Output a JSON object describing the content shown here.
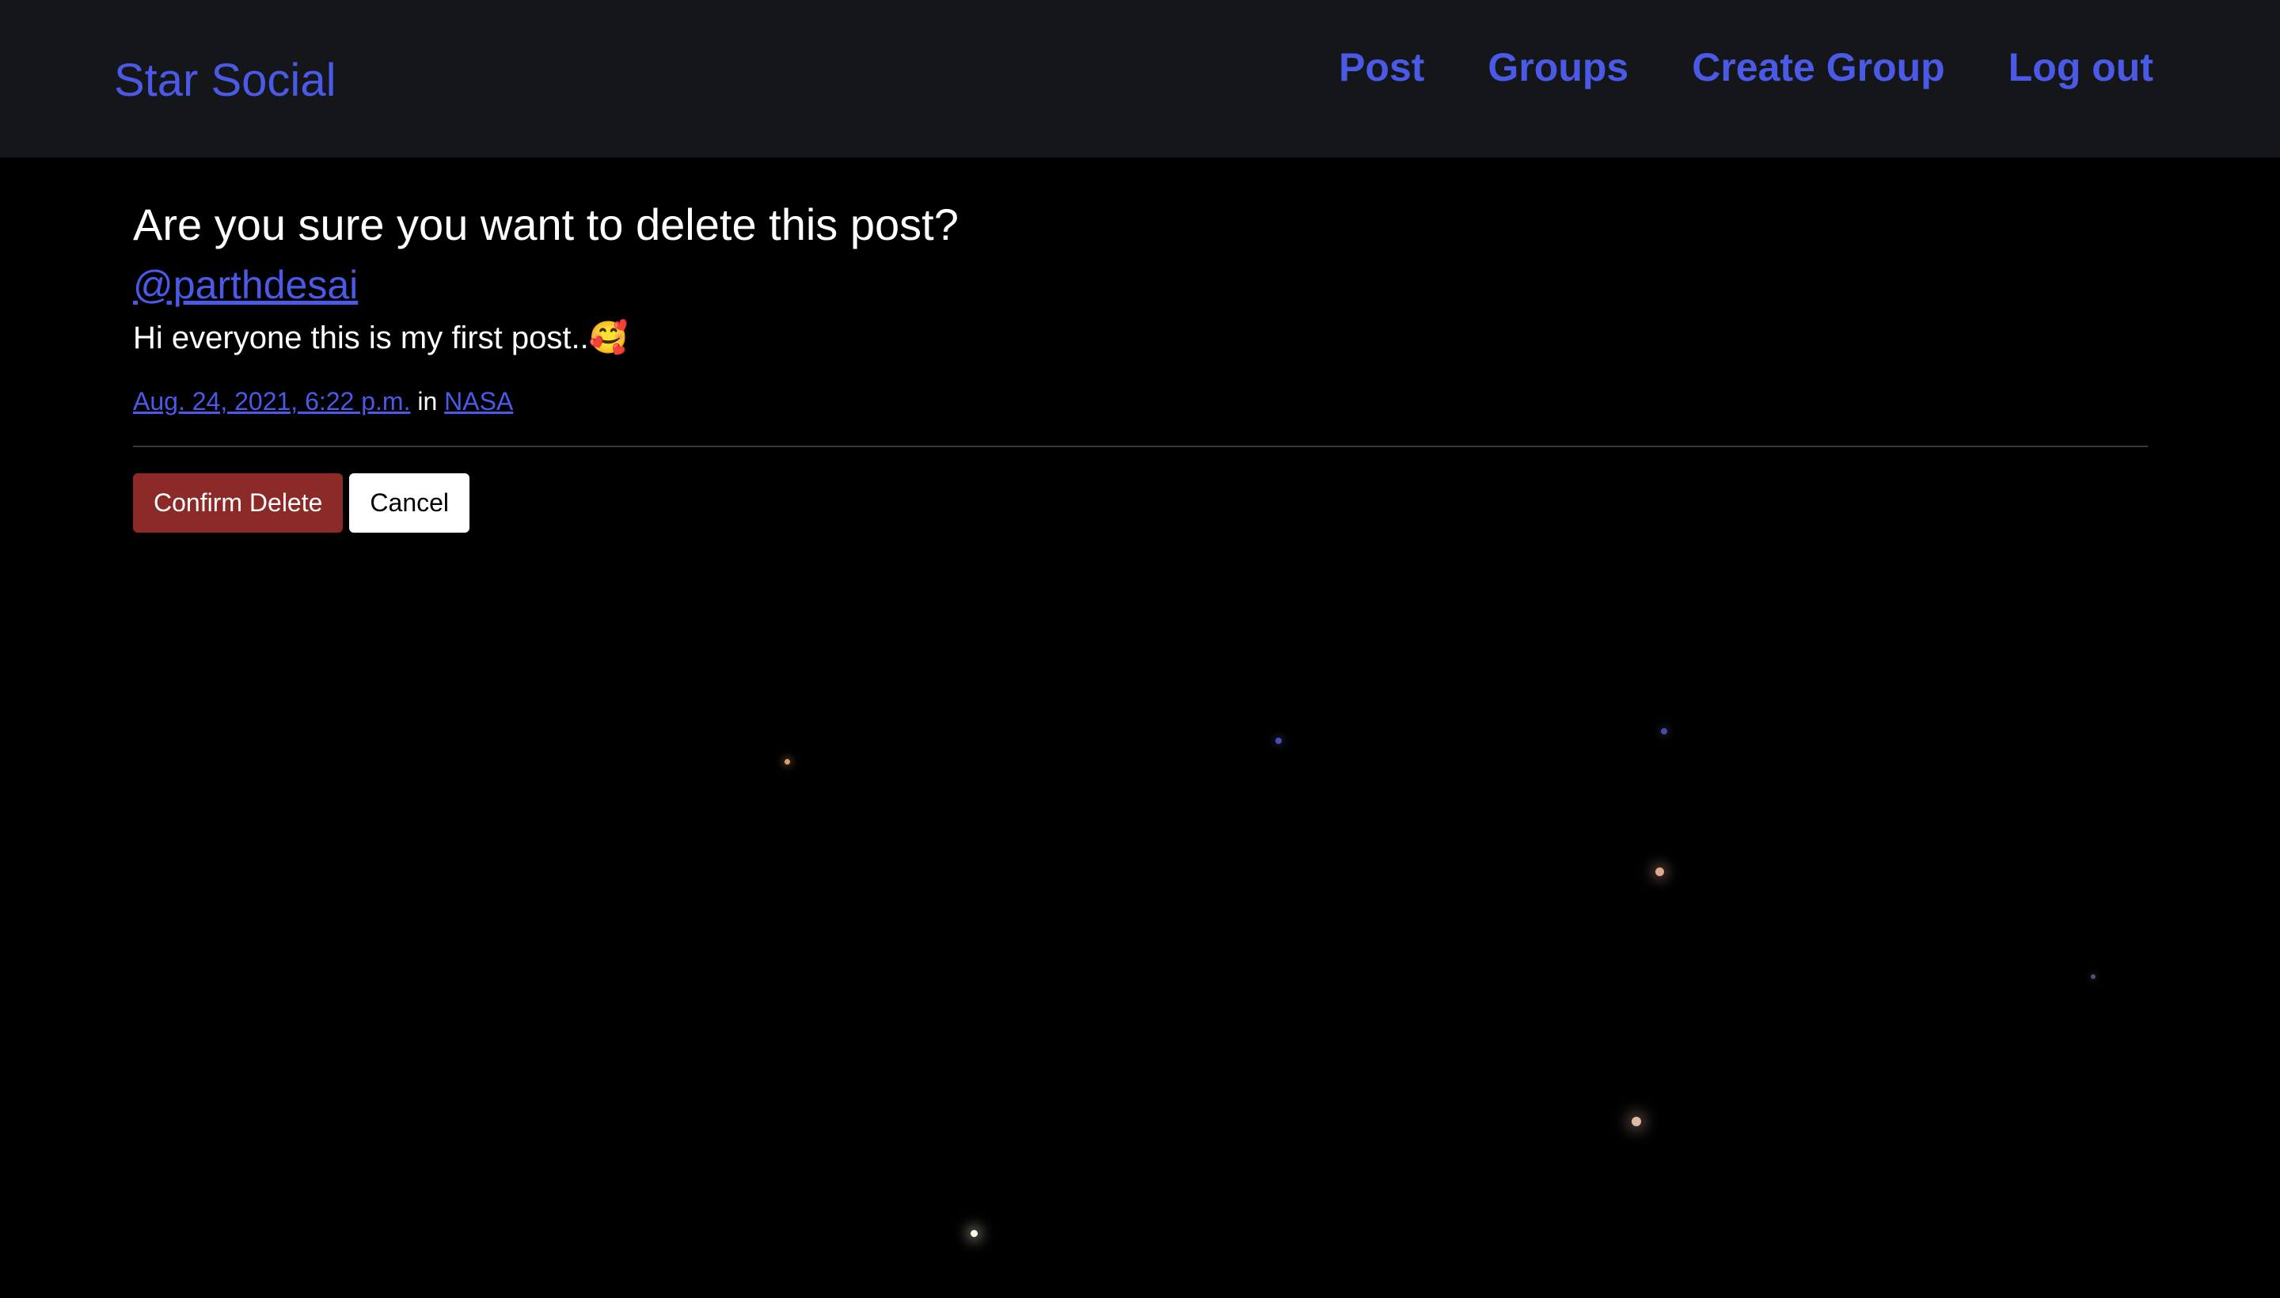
{
  "navbar": {
    "brand": "Star Social",
    "links": [
      "Post",
      "Groups",
      "Create Group",
      "Log out"
    ]
  },
  "delete_confirm": {
    "heading": "Are you sure you want to delete this post?",
    "author": "@parthdesai",
    "message": "Hi everyone this is my first post..🥰",
    "timestamp": "Aug. 24, 2021, 6:22 p.m.",
    "in_text": "in",
    "group": "NASA",
    "confirm_label": "Confirm Delete",
    "cancel_label": "Cancel"
  },
  "colors": {
    "accent": "#4a5ae6",
    "navbar_bg": "#15161a",
    "page_bg": "#000000",
    "danger": "#8b2a26"
  }
}
